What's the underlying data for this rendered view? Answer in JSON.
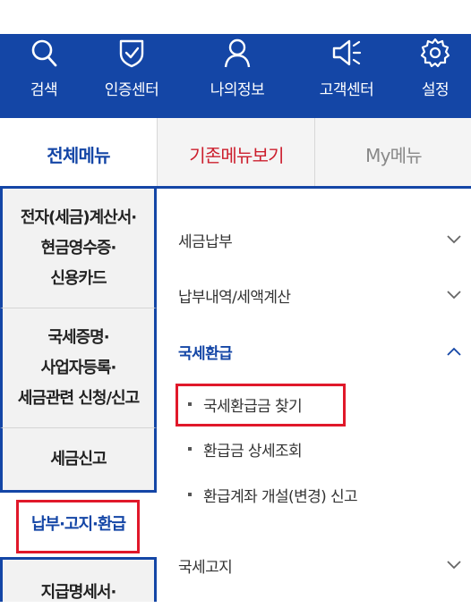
{
  "top_nav": [
    {
      "label": "검색",
      "icon": "search-icon"
    },
    {
      "label": "인증센터",
      "icon": "shield-check-icon"
    },
    {
      "label": "나의정보",
      "icon": "user-icon"
    },
    {
      "label": "고객센터",
      "icon": "megaphone-icon"
    },
    {
      "label": "설정",
      "icon": "gear-icon"
    }
  ],
  "tabs": [
    {
      "label": "전체메뉴",
      "active": true
    },
    {
      "label": "기존메뉴보기",
      "active": false
    },
    {
      "label": "My메뉴",
      "active": false
    }
  ],
  "left_menu": [
    {
      "line1": "전자(세금)계산서·",
      "line2": "현금영수증·",
      "line3": "신용카드"
    },
    {
      "line1": "국세증명·",
      "line2": "사업자등록·",
      "line3": "세금관련 신청/신고"
    },
    {
      "line1": "세금신고"
    },
    {
      "line1": "납부·고지·환급",
      "selected": true
    },
    {
      "line1": "지급명세서·"
    }
  ],
  "right_menu": [
    {
      "label": "세금납부",
      "state": "collapsed"
    },
    {
      "label": "납부내역/세액계산",
      "state": "collapsed"
    },
    {
      "label": "국세환급",
      "state": "expanded",
      "children": [
        "국세환급금 찾기",
        "환급금 상세조회",
        "환급계좌 개설(변경) 신고"
      ]
    },
    {
      "label": "국세고지",
      "state": "collapsed"
    }
  ],
  "colors": {
    "brand_blue": "#1446a6",
    "highlight_red": "#e0182a",
    "tab_red": "#cc1f2e"
  }
}
